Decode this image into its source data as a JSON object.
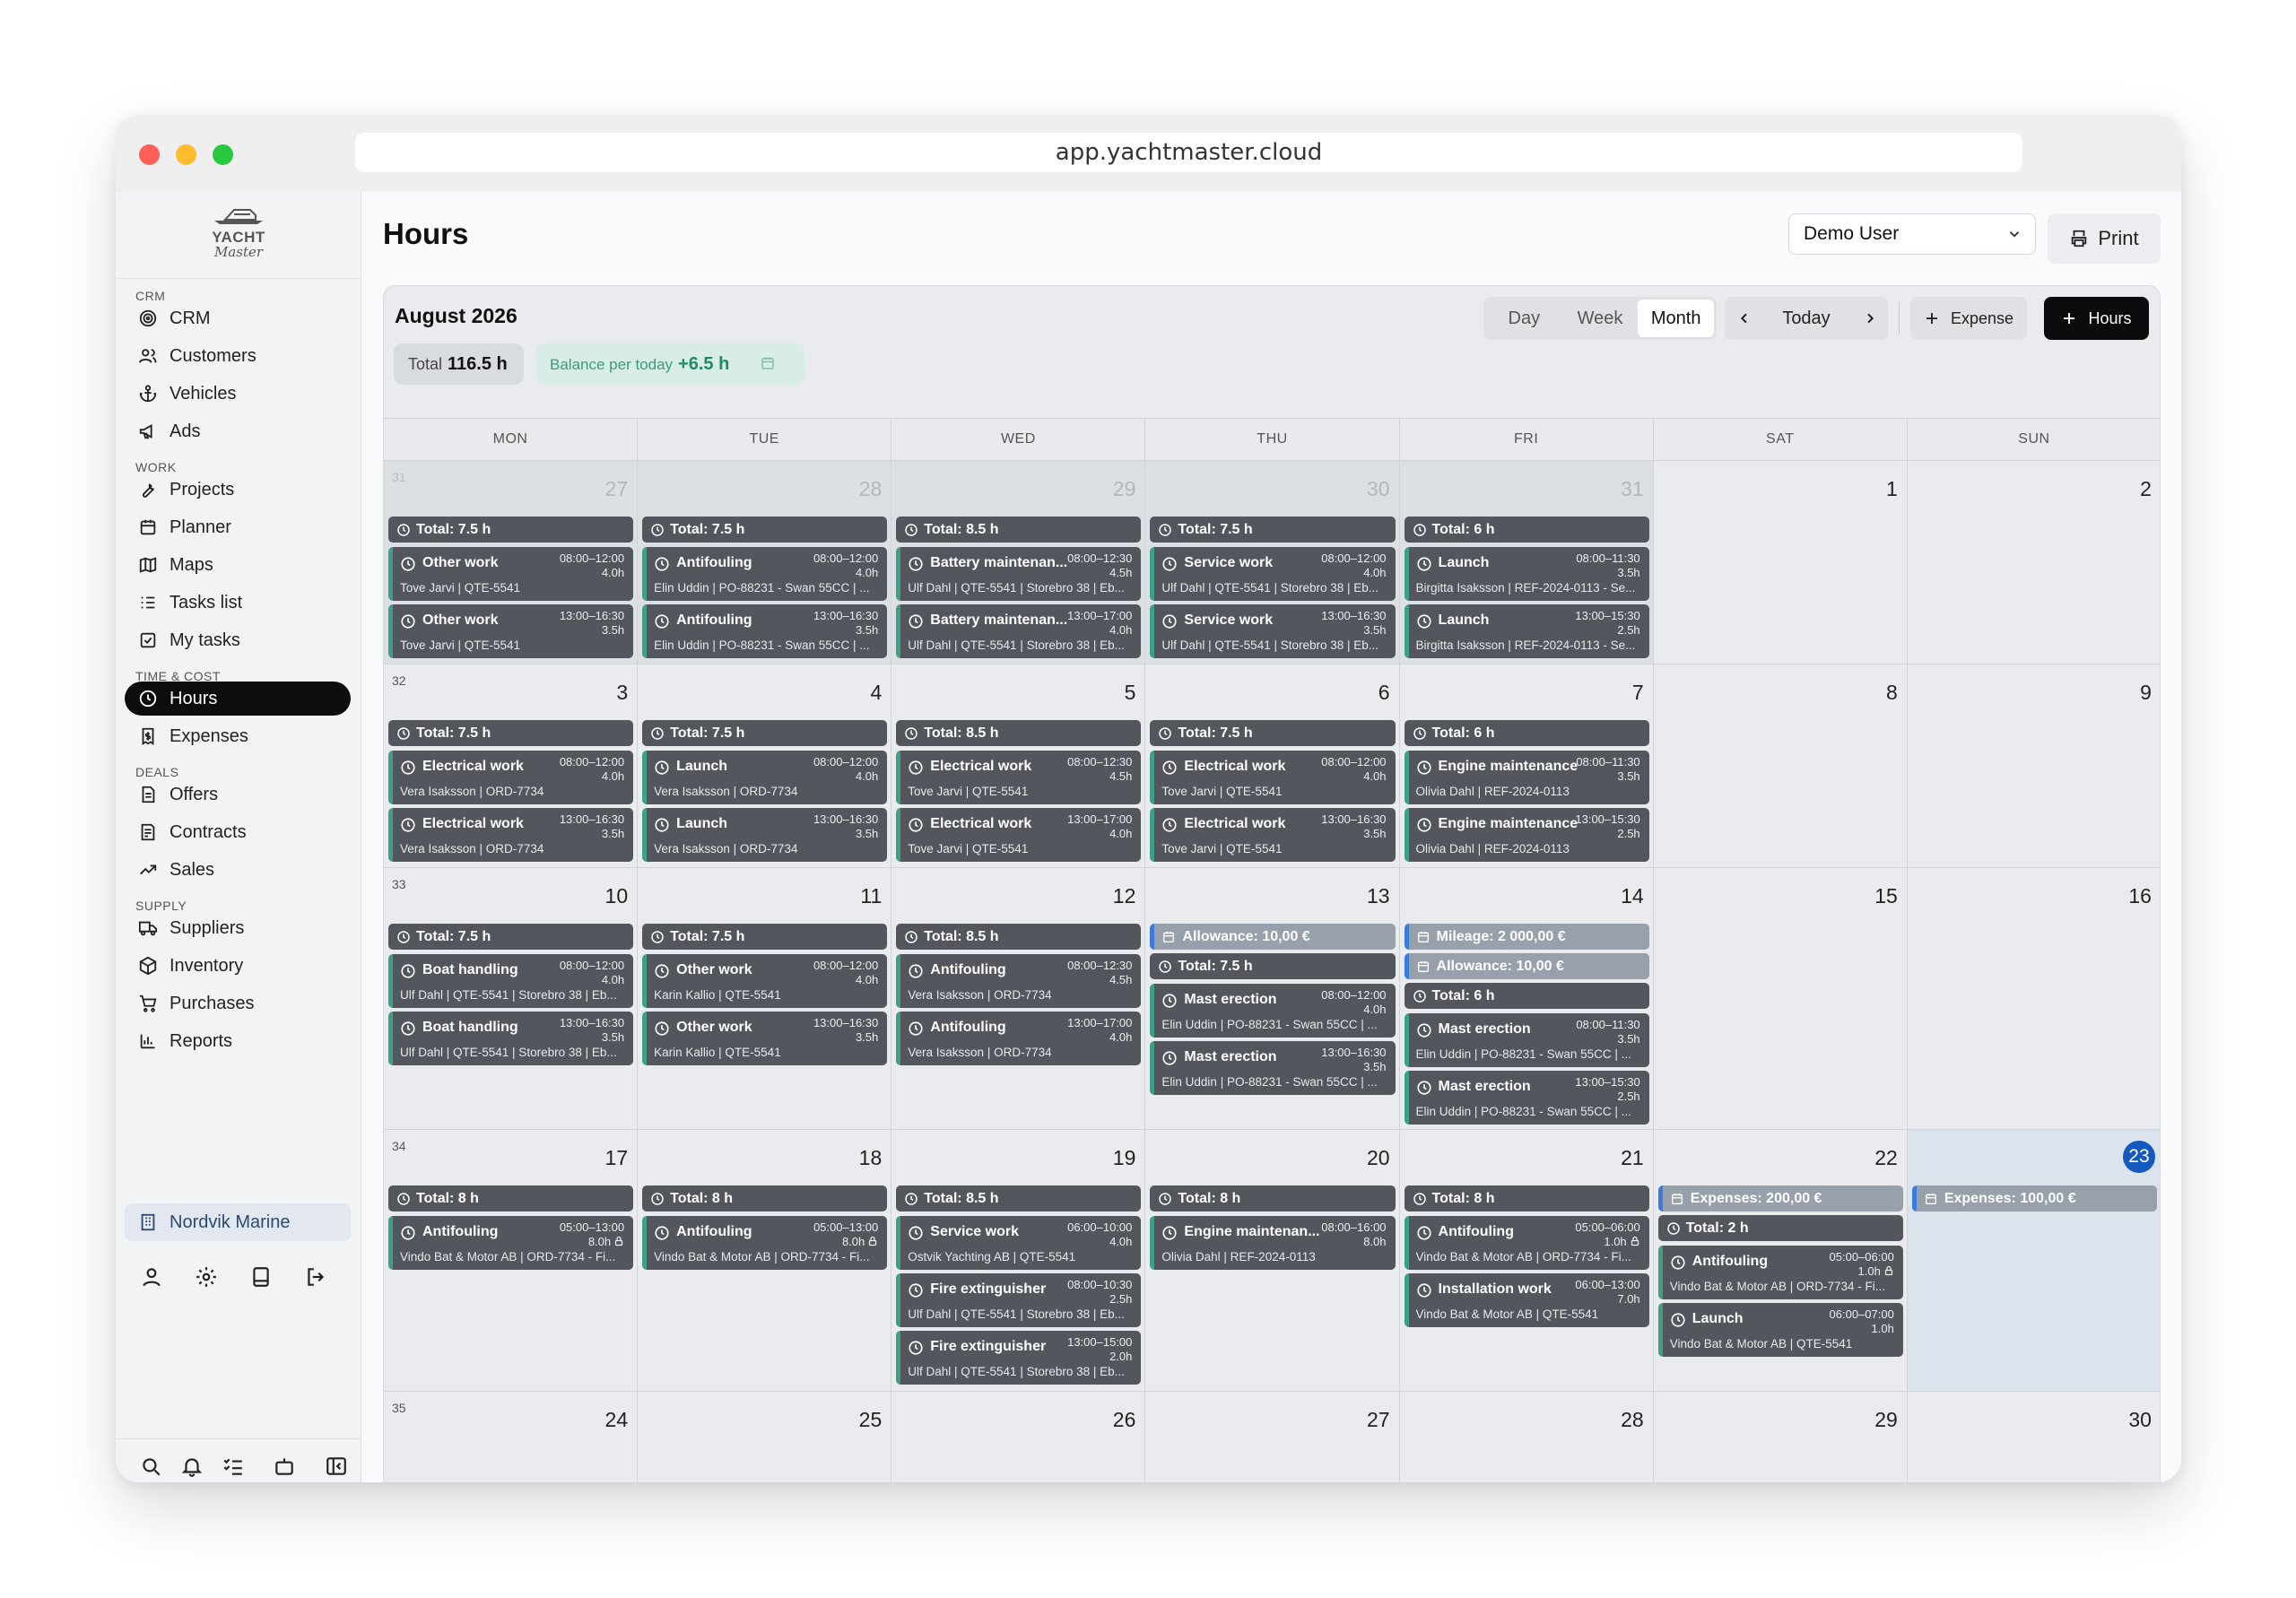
{
  "browser": {
    "url": "app.yachtmaster.cloud"
  },
  "logo": {
    "line1": "YACHT",
    "line2": "Master"
  },
  "sidebar": {
    "sections": [
      {
        "label": "CRM",
        "items": [
          {
            "label": "CRM",
            "icon": "target-icon"
          },
          {
            "label": "Customers",
            "icon": "users-icon"
          },
          {
            "label": "Vehicles",
            "icon": "anchor-icon"
          },
          {
            "label": "Ads",
            "icon": "megaphone-icon"
          }
        ]
      },
      {
        "label": "WORK",
        "items": [
          {
            "label": "Projects",
            "icon": "wrench-icon"
          },
          {
            "label": "Planner",
            "icon": "calendar-icon"
          },
          {
            "label": "Maps",
            "icon": "map-icon"
          },
          {
            "label": "Tasks list",
            "icon": "list-icon"
          },
          {
            "label": "My tasks",
            "icon": "check-square-icon"
          }
        ]
      },
      {
        "label": "TIME & COST",
        "items": [
          {
            "label": "Hours",
            "icon": "clock-icon",
            "active": true
          },
          {
            "label": "Expenses",
            "icon": "receipt-icon"
          }
        ]
      },
      {
        "label": "DEALS",
        "items": [
          {
            "label": "Offers",
            "icon": "document-icon"
          },
          {
            "label": "Contracts",
            "icon": "contract-icon"
          },
          {
            "label": "Sales",
            "icon": "trend-icon"
          }
        ]
      },
      {
        "label": "SUPPLY",
        "items": [
          {
            "label": "Suppliers",
            "icon": "truck-icon"
          },
          {
            "label": "Inventory",
            "icon": "box-icon"
          },
          {
            "label": "Purchases",
            "icon": "cart-icon"
          },
          {
            "label": "Reports",
            "icon": "bar-chart-icon"
          }
        ]
      }
    ],
    "organization": "Nordvik Marine"
  },
  "page": {
    "title": "Hours",
    "user_select": "Demo User",
    "print_label": "Print"
  },
  "calendar": {
    "month_label": "August 2026",
    "total_label": "Total",
    "total_value": "116.5 h",
    "balance_label": "Balance per today",
    "balance_value": "+6.5 h",
    "views": [
      "Day",
      "Week",
      "Month"
    ],
    "active_view": "Month",
    "today_label": "Today",
    "expense_button": "Expense",
    "hours_button": "Hours",
    "weekdays": [
      "MON",
      "TUE",
      "WED",
      "THU",
      "FRI",
      "SAT",
      "SUN"
    ],
    "weeks": [
      {
        "week": "31",
        "days": [
          {
            "day": "27",
            "other": true,
            "total": "Total: 7.5 h",
            "events": [
              {
                "title": "Other work",
                "time": "08:00–12:00",
                "dur": "4.0h",
                "sub": "Tove Jarvi | QTE-5541"
              },
              {
                "title": "Other work",
                "time": "13:00–16:30",
                "dur": "3.5h",
                "sub": "Tove Jarvi | QTE-5541"
              }
            ]
          },
          {
            "day": "28",
            "other": true,
            "total": "Total: 7.5 h",
            "events": [
              {
                "title": "Antifouling",
                "time": "08:00–12:00",
                "dur": "4.0h",
                "sub": "Elin Uddin | PO-88231 - Swan 55CC | ..."
              },
              {
                "title": "Antifouling",
                "time": "13:00–16:30",
                "dur": "3.5h",
                "sub": "Elin Uddin | PO-88231 - Swan 55CC | ..."
              }
            ]
          },
          {
            "day": "29",
            "other": true,
            "total": "Total: 8.5 h",
            "events": [
              {
                "title": "Battery maintenan...",
                "time": "08:00–12:30",
                "dur": "4.5h",
                "sub": "Ulf Dahl | QTE-5541 | Storebro 38 | Eb..."
              },
              {
                "title": "Battery maintenan...",
                "time": "13:00–17:00",
                "dur": "4.0h",
                "sub": "Ulf Dahl | QTE-5541 | Storebro 38 | Eb..."
              }
            ]
          },
          {
            "day": "30",
            "other": true,
            "total": "Total: 7.5 h",
            "events": [
              {
                "title": "Service work",
                "time": "08:00–12:00",
                "dur": "4.0h",
                "sub": "Ulf Dahl | QTE-5541 | Storebro 38 | Eb..."
              },
              {
                "title": "Service work",
                "time": "13:00–16:30",
                "dur": "3.5h",
                "sub": "Ulf Dahl | QTE-5541 | Storebro 38 | Eb..."
              }
            ]
          },
          {
            "day": "31",
            "other": true,
            "total": "Total: 6 h",
            "events": [
              {
                "title": "Launch",
                "time": "08:00–11:30",
                "dur": "3.5h",
                "sub": "Birgitta Isaksson | REF-2024-0113 - Se..."
              },
              {
                "title": "Launch",
                "time": "13:00–15:30",
                "dur": "2.5h",
                "sub": "Birgitta Isaksson | REF-2024-0113 - Se..."
              }
            ]
          },
          {
            "day": "1"
          },
          {
            "day": "2"
          }
        ]
      },
      {
        "week": "32",
        "days": [
          {
            "day": "3",
            "total": "Total: 7.5 h",
            "events": [
              {
                "title": "Electrical work",
                "time": "08:00–12:00",
                "dur": "4.0h",
                "sub": "Vera Isaksson | ORD-7734"
              },
              {
                "title": "Electrical work",
                "time": "13:00–16:30",
                "dur": "3.5h",
                "sub": "Vera Isaksson | ORD-7734"
              }
            ]
          },
          {
            "day": "4",
            "total": "Total: 7.5 h",
            "events": [
              {
                "title": "Launch",
                "time": "08:00–12:00",
                "dur": "4.0h",
                "sub": "Vera Isaksson | ORD-7734"
              },
              {
                "title": "Launch",
                "time": "13:00–16:30",
                "dur": "3.5h",
                "sub": "Vera Isaksson | ORD-7734"
              }
            ]
          },
          {
            "day": "5",
            "total": "Total: 8.5 h",
            "events": [
              {
                "title": "Electrical work",
                "time": "08:00–12:30",
                "dur": "4.5h",
                "sub": "Tove Jarvi | QTE-5541"
              },
              {
                "title": "Electrical work",
                "time": "13:00–17:00",
                "dur": "4.0h",
                "sub": "Tove Jarvi | QTE-5541"
              }
            ]
          },
          {
            "day": "6",
            "total": "Total: 7.5 h",
            "events": [
              {
                "title": "Electrical work",
                "time": "08:00–12:00",
                "dur": "4.0h",
                "sub": "Tove Jarvi | QTE-5541"
              },
              {
                "title": "Electrical work",
                "time": "13:00–16:30",
                "dur": "3.5h",
                "sub": "Tove Jarvi | QTE-5541"
              }
            ]
          },
          {
            "day": "7",
            "total": "Total: 6 h",
            "events": [
              {
                "title": "Engine maintenance",
                "time": "08:00–11:30",
                "dur": "3.5h",
                "sub": "Olivia Dahl | REF-2024-0113"
              },
              {
                "title": "Engine maintenance",
                "time": "13:00–15:30",
                "dur": "2.5h",
                "sub": "Olivia Dahl | REF-2024-0113"
              }
            ]
          },
          {
            "day": "8"
          },
          {
            "day": "9"
          }
        ]
      },
      {
        "week": "33",
        "days": [
          {
            "day": "10",
            "total": "Total: 7.5 h",
            "events": [
              {
                "title": "Boat handling",
                "time": "08:00–12:00",
                "dur": "4.0h",
                "sub": "Ulf Dahl | QTE-5541 | Storebro 38 | Eb..."
              },
              {
                "title": "Boat handling",
                "time": "13:00–16:30",
                "dur": "3.5h",
                "sub": "Ulf Dahl | QTE-5541 | Storebro 38 | Eb..."
              }
            ]
          },
          {
            "day": "11",
            "total": "Total: 7.5 h",
            "events": [
              {
                "title": "Other work",
                "time": "08:00–12:00",
                "dur": "4.0h",
                "sub": "Karin Kallio | QTE-5541"
              },
              {
                "title": "Other work",
                "time": "13:00–16:30",
                "dur": "3.5h",
                "sub": "Karin Kallio | QTE-5541"
              }
            ]
          },
          {
            "day": "12",
            "total": "Total: 8.5 h",
            "events": [
              {
                "title": "Antifouling",
                "time": "08:00–12:30",
                "dur": "4.5h",
                "sub": "Vera Isaksson | ORD-7734"
              },
              {
                "title": "Antifouling",
                "time": "13:00–17:00",
                "dur": "4.0h",
                "sub": "Vera Isaksson | ORD-7734"
              }
            ]
          },
          {
            "day": "13",
            "expenses": [
              "Allowance: 10,00 €"
            ],
            "total": "Total: 7.5 h",
            "events": [
              {
                "title": "Mast erection",
                "time": "08:00–12:00",
                "dur": "4.0h",
                "sub": "Elin Uddin | PO-88231 - Swan 55CC | ..."
              },
              {
                "title": "Mast erection",
                "time": "13:00–16:30",
                "dur": "3.5h",
                "sub": "Elin Uddin | PO-88231 - Swan 55CC | ..."
              }
            ]
          },
          {
            "day": "14",
            "expenses": [
              "Mileage: 2 000,00 €",
              "Allowance: 10,00 €"
            ],
            "total": "Total: 6 h",
            "events": [
              {
                "title": "Mast erection",
                "time": "08:00–11:30",
                "dur": "3.5h",
                "sub": "Elin Uddin | PO-88231 - Swan 55CC | ..."
              },
              {
                "title": "Mast erection",
                "time": "13:00–15:30",
                "dur": "2.5h",
                "sub": "Elin Uddin | PO-88231 - Swan 55CC | ..."
              }
            ]
          },
          {
            "day": "15"
          },
          {
            "day": "16"
          }
        ]
      },
      {
        "week": "34",
        "days": [
          {
            "day": "17",
            "total": "Total: 8 h",
            "events": [
              {
                "title": "Antifouling",
                "time": "05:00–13:00",
                "dur": "8.0h",
                "lock": true,
                "sub": "Vindo Bat & Motor AB | ORD-7734 - Fi..."
              }
            ]
          },
          {
            "day": "18",
            "total": "Total: 8 h",
            "events": [
              {
                "title": "Antifouling",
                "time": "05:00–13:00",
                "dur": "8.0h",
                "lock": true,
                "sub": "Vindo Bat & Motor AB | ORD-7734 - Fi..."
              }
            ]
          },
          {
            "day": "19",
            "total": "Total: 8.5 h",
            "events": [
              {
                "title": "Service work",
                "time": "06:00–10:00",
                "dur": "4.0h",
                "sub": "Ostvik Yachting AB | QTE-5541"
              },
              {
                "title": "Fire extinguisher",
                "time": "08:00–10:30",
                "dur": "2.5h",
                "sub": "Ulf Dahl | QTE-5541 | Storebro 38 | Eb..."
              },
              {
                "title": "Fire extinguisher",
                "time": "13:00–15:00",
                "dur": "2.0h",
                "sub": "Ulf Dahl | QTE-5541 | Storebro 38 | Eb..."
              }
            ]
          },
          {
            "day": "20",
            "total": "Total: 8 h",
            "events": [
              {
                "title": "Engine maintenan...",
                "time": "08:00–16:00",
                "dur": "8.0h",
                "sub": "Olivia Dahl | REF-2024-0113"
              }
            ]
          },
          {
            "day": "21",
            "total": "Total: 8 h",
            "events": [
              {
                "title": "Antifouling",
                "time": "05:00–06:00",
                "dur": "1.0h",
                "lock": true,
                "sub": "Vindo Bat & Motor AB | ORD-7734 - Fi..."
              },
              {
                "title": "Installation work",
                "time": "06:00–13:00",
                "dur": "7.0h",
                "sub": "Vindo Bat & Motor AB | QTE-5541"
              }
            ]
          },
          {
            "day": "22",
            "expenses": [
              "Expenses: 200,00 €"
            ],
            "total": "Total: 2 h",
            "events": [
              {
                "title": "Antifouling",
                "time": "05:00–06:00",
                "dur": "1.0h",
                "lock": true,
                "sub": "Vindo Bat & Motor AB | ORD-7734 - Fi..."
              },
              {
                "title": "Launch",
                "time": "06:00–07:00",
                "dur": "1.0h",
                "sub": "Vindo Bat & Motor AB | QTE-5541"
              }
            ]
          },
          {
            "day": "23",
            "today": true,
            "expenses": [
              "Expenses: 100,00 €"
            ]
          }
        ]
      },
      {
        "week": "35",
        "days": [
          {
            "day": "24"
          },
          {
            "day": "25"
          },
          {
            "day": "26"
          },
          {
            "day": "27"
          },
          {
            "day": "28"
          },
          {
            "day": "29"
          },
          {
            "day": "30"
          }
        ]
      }
    ]
  },
  "colors": {
    "accent": "#0b0b0d",
    "event_bg": "#53575d",
    "event_stripe": "#3e9e86",
    "expense_stripe": "#3b7bd9",
    "today_badge": "#1558c0",
    "balance": "#1f8a6a"
  }
}
